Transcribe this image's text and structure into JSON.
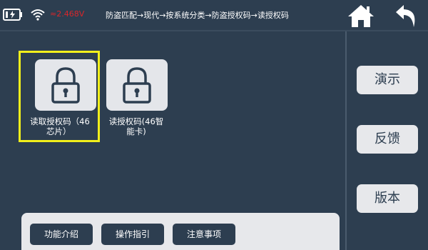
{
  "status": {
    "voltage": "≈2.468V"
  },
  "header": {
    "breadcrumb": "防盗匹配→现代→按系统分类→防盗授权码→读授权码"
  },
  "tiles": [
    {
      "label_line1": "读取授权码（46",
      "label_line2": "芯片）",
      "selected": true
    },
    {
      "label_line1": "读授权码(46智",
      "label_line2": "能卡)",
      "selected": false
    }
  ],
  "sidebar": {
    "buttons": [
      "演示",
      "反馈",
      "版本"
    ]
  },
  "footer": {
    "buttons": [
      "功能介绍",
      "操作指引",
      "注意事项"
    ]
  },
  "colors": {
    "background": "#2d3e50",
    "selection": "#f2ef1b",
    "voltage": "#d9262a",
    "tile": "#e4e6ea"
  }
}
